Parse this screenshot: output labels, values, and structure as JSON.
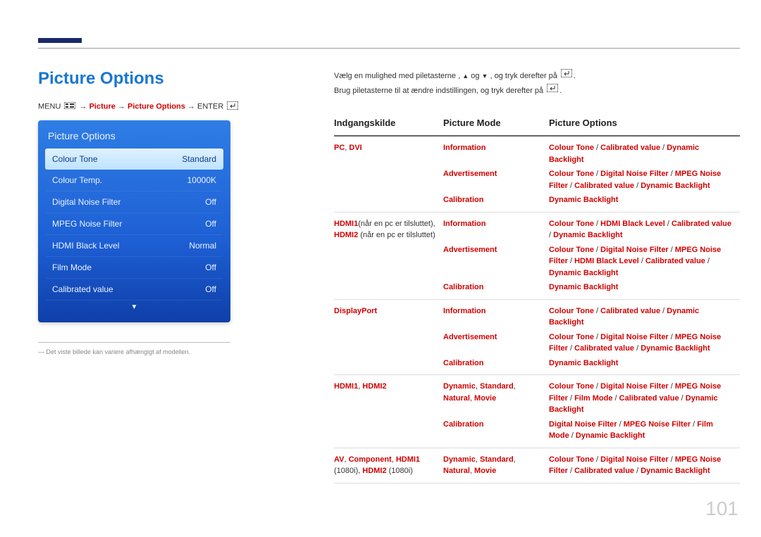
{
  "title": "Picture Options",
  "page_number": "101",
  "breadcrumb": {
    "menu": "MENU",
    "picture": "Picture",
    "picture_options": "Picture Options",
    "enter": "ENTER"
  },
  "menu_panel": {
    "title": "Picture Options",
    "rows": [
      {
        "label": "Colour Tone",
        "value": "Standard",
        "selected": true
      },
      {
        "label": "Colour Temp.",
        "value": "10000K",
        "selected": false
      },
      {
        "label": "Digital Noise Filter",
        "value": "Off",
        "selected": false
      },
      {
        "label": "MPEG Noise Filter",
        "value": "Off",
        "selected": false
      },
      {
        "label": "HDMI Black Level",
        "value": "Normal",
        "selected": false
      },
      {
        "label": "Film Mode",
        "value": "Off",
        "selected": false
      },
      {
        "label": "Calibrated value",
        "value": "Off",
        "selected": false
      }
    ]
  },
  "footnote": "― Det viste billede kan variere afhængigt af modellen.",
  "instructions": {
    "line1_pre": "Vælg en mulighed med piletasterne ,",
    "line1_mid": "og",
    "line1_post": ", og tryk derefter på",
    "line2_pre": "Brug piletasterne til at ændre indstillingen, og tryk derefter på"
  },
  "table": {
    "headers": {
      "src": "Indgangskilde",
      "mode": "Picture Mode",
      "opts": "Picture Options"
    },
    "groups": [
      {
        "src_html": "<span class='r'>PC</span><span class='n'>, </span><span class='r'>DVI</span>",
        "rows": [
          {
            "mode": "<span class='r'>Information</span>",
            "opts": "<span class='r'>Colour Tone</span><span class='n'> / </span><span class='r'>Calibrated value</span><span class='n'> / </span><span class='r'>Dynamic Backlight</span>"
          },
          {
            "mode": "<span class='r'>Advertisement</span>",
            "opts": "<span class='r'>Colour Tone</span><span class='n'> / </span><span class='r'>Digital Noise Filter</span><span class='n'> / </span><span class='r'>MPEG Noise Filter</span><span class='n'> / </span><span class='r'>Calibrated value</span><span class='n'> / </span><span class='r'>Dynamic Backlight</span>"
          },
          {
            "mode": "<span class='r'>Calibration</span>",
            "opts": "<span class='r'>Dynamic Backlight</span>"
          }
        ]
      },
      {
        "src_html": "<span class='r'>HDMI1</span><span class='n'>(når en pc er tilsluttet), </span><span class='r'>HDMI2</span><span class='n'> (når en pc er tilsluttet)</span>",
        "rows": [
          {
            "mode": "<span class='r'>Information</span>",
            "opts": "<span class='r'>Colour Tone</span><span class='n'> / </span><span class='r'>HDMI Black Level</span><span class='n'> / </span><span class='r'>Calibrated value</span><span class='n'> / </span><span class='r'>Dynamic Backlight</span>"
          },
          {
            "mode": "<span class='r'>Advertisement</span>",
            "opts": "<span class='r'>Colour Tone</span><span class='n'> / </span><span class='r'>Digital Noise Filter</span><span class='n'> / </span><span class='r'>MPEG Noise Filter</span><span class='n'> / </span><span class='r'>HDMI Black Level</span><span class='n'> / </span><span class='r'>Calibrated value</span><span class='n'> / </span><span class='r'>Dynamic Backlight</span>"
          },
          {
            "mode": "<span class='r'>Calibration</span>",
            "opts": "<span class='r'>Dynamic Backlight</span>"
          }
        ]
      },
      {
        "src_html": "<span class='r'>DisplayPort</span>",
        "rows": [
          {
            "mode": "<span class='r'>Information</span>",
            "opts": "<span class='r'>Colour Tone</span><span class='n'> / </span><span class='r'>Calibrated value</span><span class='n'> / </span><span class='r'>Dynamic Backlight</span>"
          },
          {
            "mode": "<span class='r'>Advertisement</span>",
            "opts": "<span class='r'>Colour Tone</span><span class='n'> / </span><span class='r'>Digital Noise Filter</span><span class='n'> / </span><span class='r'>MPEG Noise Filter</span><span class='n'> / </span><span class='r'>Calibrated value</span><span class='n'> / </span><span class='r'>Dynamic Backlight</span>"
          },
          {
            "mode": "<span class='r'>Calibration</span>",
            "opts": "<span class='r'>Dynamic Backlight</span>"
          }
        ]
      },
      {
        "src_html": "<span class='r'>HDMI1</span><span class='n'>, </span><span class='r'>HDMI2</span>",
        "rows": [
          {
            "mode": "<span class='r'>Dynamic</span><span class='n'>, </span><span class='r'>Standard</span><span class='n'>, </span><span class='r'>Natural</span><span class='n'>, </span><span class='r'>Movie</span>",
            "opts": "<span class='r'>Colour Tone</span><span class='n'> / </span><span class='r'>Digital Noise Filter</span><span class='n'> / </span><span class='r'>MPEG Noise Filter</span><span class='n'> / </span><span class='r'>Film Mode</span><span class='n'> / </span><span class='r'>Calibrated value</span><span class='n'> / </span><span class='r'>Dynamic Backlight</span>"
          },
          {
            "mode": "<span class='r'>Calibration</span>",
            "opts": "<span class='r'>Digital Noise Filter</span><span class='n'> / </span><span class='r'>MPEG Noise Filter</span><span class='n'> / </span><span class='r'>Film Mode</span><span class='n'> / </span><span class='r'>Dynamic Backlight</span>"
          }
        ]
      },
      {
        "src_html": "<span class='r'>AV</span><span class='n'>, </span><span class='r'>Component</span><span class='n'>, </span><span class='r'>HDMI1</span><span class='n'> (1080i), </span><span class='r'>HDMI2</span><span class='n'> (1080i)</span>",
        "rows": [
          {
            "mode": "<span class='r'>Dynamic</span><span class='n'>, </span><span class='r'>Standard</span><span class='n'>, </span><span class='r'>Natural</span><span class='n'>, </span><span class='r'>Movie</span>",
            "opts": "<span class='r'>Colour Tone</span><span class='n'> / </span><span class='r'>Digital Noise Filter</span><span class='n'> / </span><span class='r'>MPEG Noise Filter</span><span class='n'> / </span><span class='r'>Calibrated value</span><span class='n'> / </span><span class='r'>Dynamic Backlight</span>"
          }
        ]
      }
    ]
  }
}
